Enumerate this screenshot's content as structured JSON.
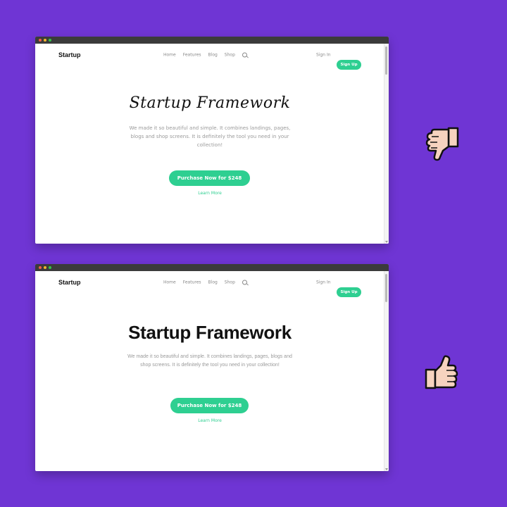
{
  "variants": [
    {
      "nav": {
        "logo": "Startup",
        "links": [
          "Home",
          "Features",
          "Blog",
          "Shop"
        ],
        "sign_in": "Sign In",
        "sign_up": "Sign Up"
      },
      "hero": {
        "title": "Startup Framework",
        "description": "We made it so beautiful and simple. It combines landings, pages, blogs and shop screens. It is definitely the tool you need in your collection!",
        "cta": "Purchase Now for $248",
        "learn_more": "Learn More"
      },
      "verdict_icon": "thumbs-down-icon"
    },
    {
      "nav": {
        "logo": "Startup",
        "links": [
          "Home",
          "Features",
          "Blog",
          "Shop"
        ],
        "sign_in": "Sign In",
        "sign_up": "Sign Up"
      },
      "hero": {
        "title": "Startup Framework",
        "description": "We made it so beautiful and simple. It combines landings, pages, blogs and shop screens. It is definitely the tool you need in your collection!",
        "cta": "Purchase Now for $248",
        "learn_more": "Learn More"
      },
      "verdict_icon": "thumbs-up-icon"
    }
  ],
  "colors": {
    "background": "#6f35d4",
    "accent": "#2ecf91",
    "titlebar": "#3b3b3b"
  }
}
